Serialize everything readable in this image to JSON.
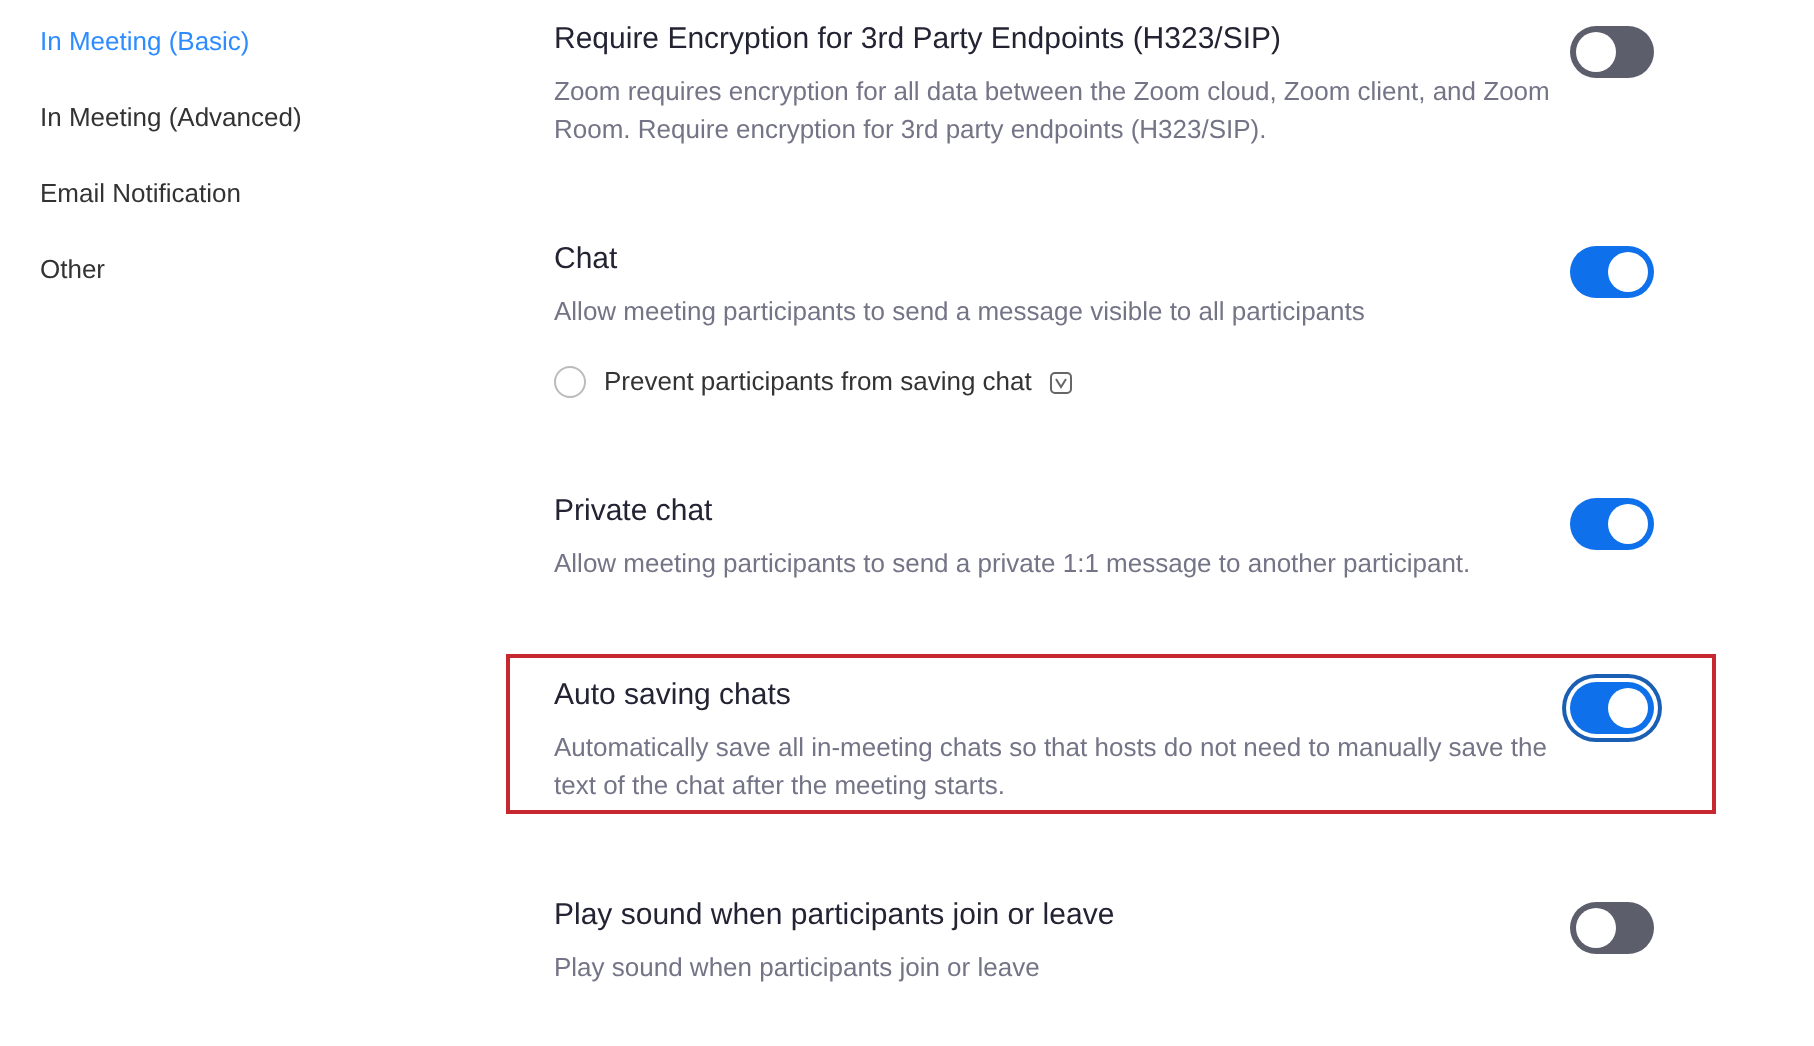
{
  "sidebar": {
    "items": [
      {
        "label": "In Meeting (Basic)",
        "selected": true
      },
      {
        "label": "In Meeting (Advanced)",
        "selected": false
      },
      {
        "label": "Email Notification",
        "selected": false
      },
      {
        "label": "Other",
        "selected": false
      }
    ]
  },
  "settings": [
    {
      "title": "Require Encryption for 3rd Party Endpoints (H323/SIP)",
      "description": "Zoom requires encryption for all data between the Zoom cloud, Zoom client, and Zoom Room. Require encryption for 3rd party endpoints (H323/SIP).",
      "on": false,
      "highlighted": false
    },
    {
      "title": "Chat",
      "description": "Allow meeting participants to send a message visible to all participants",
      "on": true,
      "highlighted": false,
      "options": [
        {
          "label": "Prevent participants from saving chat",
          "checked": false
        }
      ]
    },
    {
      "title": "Private chat",
      "description": "Allow meeting participants to send a private 1:1 message to another participant.",
      "on": true,
      "highlighted": false
    },
    {
      "title": "Auto saving chats",
      "description": "Automatically save all in-meeting chats so that hosts do not need to manually save the text of the chat after the meeting starts.",
      "on": true,
      "highlighted": true
    },
    {
      "title": "Play sound when participants join or leave",
      "description": "Play sound when participants join or leave",
      "on": false,
      "highlighted": false
    }
  ]
}
